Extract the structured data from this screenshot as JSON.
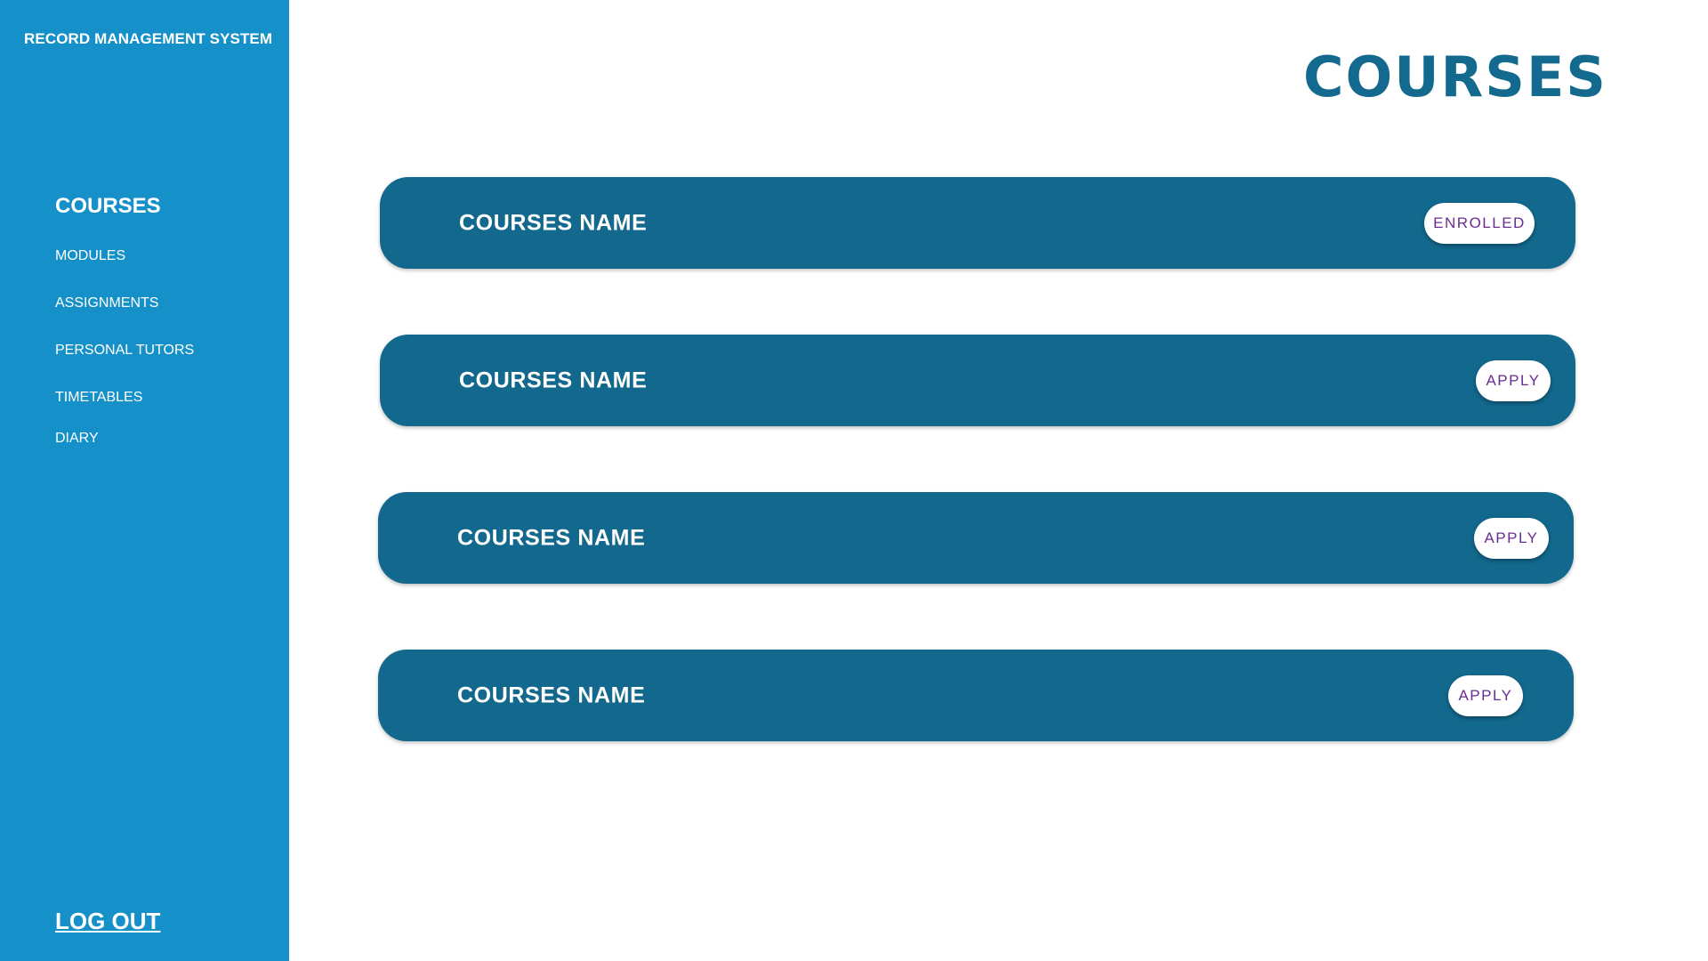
{
  "app": {
    "title": "RECORD MANAGEMENT SYSTEM"
  },
  "sidebar": {
    "items": [
      {
        "label": "COURSES",
        "active": true
      },
      {
        "label": "MODULES",
        "active": false
      },
      {
        "label": "ASSIGNMENTS",
        "active": false
      },
      {
        "label": "PERSONAL TUTORS",
        "active": false
      },
      {
        "label": "TIMETABLES",
        "active": false
      },
      {
        "label": "DIARY",
        "active": false
      }
    ],
    "logout_label": "LOG OUT"
  },
  "main": {
    "title": "COURSES",
    "courses": [
      {
        "name": "COURSES NAME",
        "action": "ENROLLED"
      },
      {
        "name": "COURSES NAME",
        "action": "APPLY"
      },
      {
        "name": "COURSES NAME",
        "action": "APPLY"
      },
      {
        "name": "COURSES NAME",
        "action": "APPLY"
      }
    ]
  },
  "colors": {
    "sidebar_bg": "#1590c8",
    "card_bg": "#12688d",
    "title": "#136a8e",
    "button_text": "#6b2c91"
  }
}
